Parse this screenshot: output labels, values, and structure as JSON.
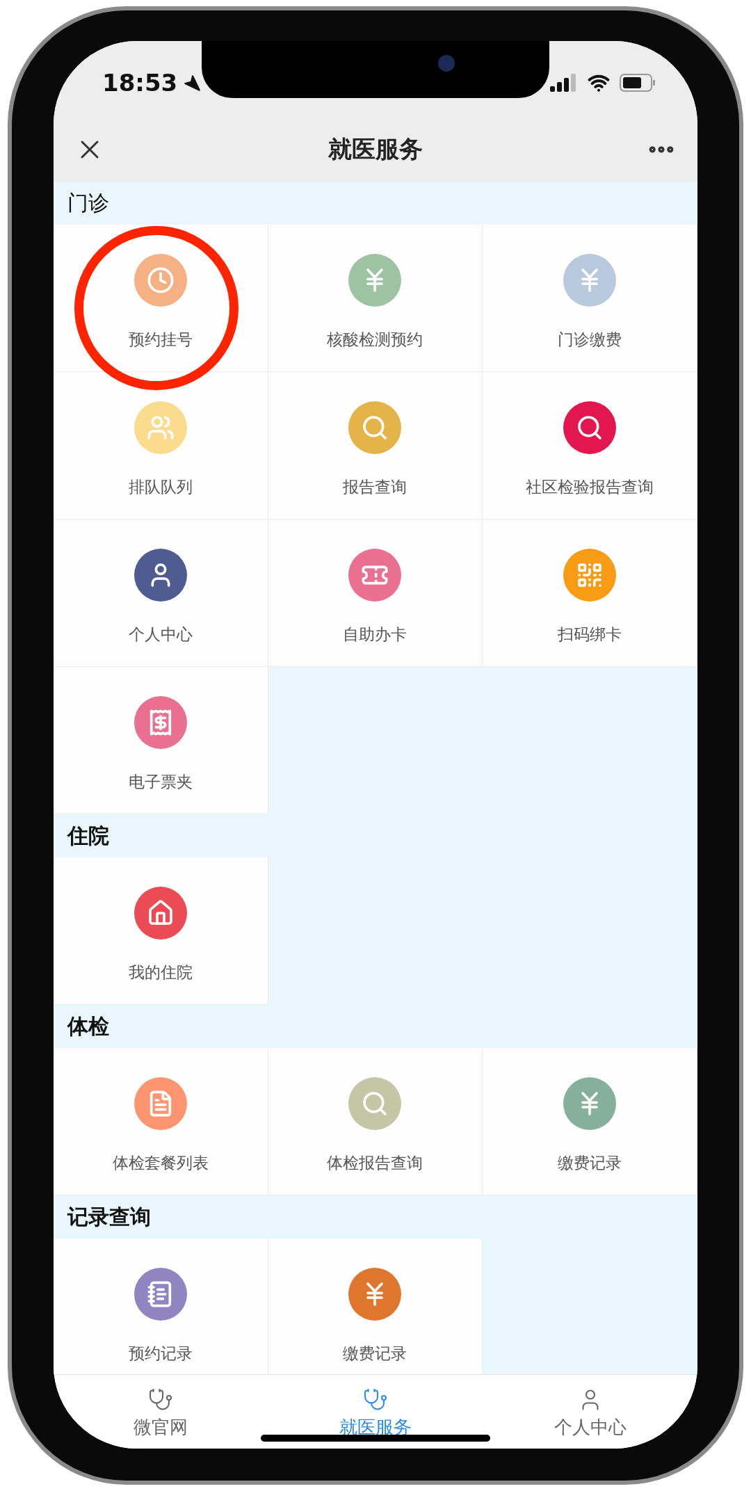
{
  "status_bar": {
    "time": "18:53"
  },
  "nav": {
    "title": "就医服务"
  },
  "sections": [
    {
      "title": "门诊",
      "items": [
        {
          "label": "预约挂号",
          "color": "#f5b183",
          "circled": true
        },
        {
          "label": "核酸检测预约",
          "color": "#9dc3a2",
          "circled": false
        },
        {
          "label": "门诊缴费",
          "color": "#b8c9dd",
          "circled": false
        },
        {
          "label": "排队队列",
          "color": "#fbdc8e",
          "circled": false
        },
        {
          "label": "报告查询",
          "color": "#e4b44a",
          "circled": false
        },
        {
          "label": "社区检验报告查询",
          "color": "#e2174f",
          "circled": false
        },
        {
          "label": "个人中心",
          "color": "#4f5c92",
          "circled": false
        },
        {
          "label": "自助办卡",
          "color": "#e9708f",
          "circled": false
        },
        {
          "label": "扫码绑卡",
          "color": "#f89c16",
          "circled": false
        },
        {
          "label": "电子票夹",
          "color": "#e9708f",
          "circled": false
        }
      ]
    },
    {
      "title": "住院",
      "items": [
        {
          "label": "我的住院",
          "color": "#ea4b55",
          "circled": false
        }
      ]
    },
    {
      "title": "体检",
      "items": [
        {
          "label": "体检套餐列表",
          "color": "#fd9670",
          "circled": false
        },
        {
          "label": "体检报告查询",
          "color": "#c4c6a5",
          "circled": false
        },
        {
          "label": "缴费记录",
          "color": "#85b09b",
          "circled": false
        }
      ]
    },
    {
      "title": "记录查询",
      "items": [
        {
          "label": "预约记录",
          "color": "#9085c0",
          "circled": false
        },
        {
          "label": "缴费记录",
          "color": "#de762e",
          "circled": false
        }
      ]
    }
  ],
  "tab_bar": [
    {
      "label": "微官网",
      "selected": false
    },
    {
      "label": "就医服务",
      "selected": true
    },
    {
      "label": "个人中心",
      "selected": false
    }
  ]
}
